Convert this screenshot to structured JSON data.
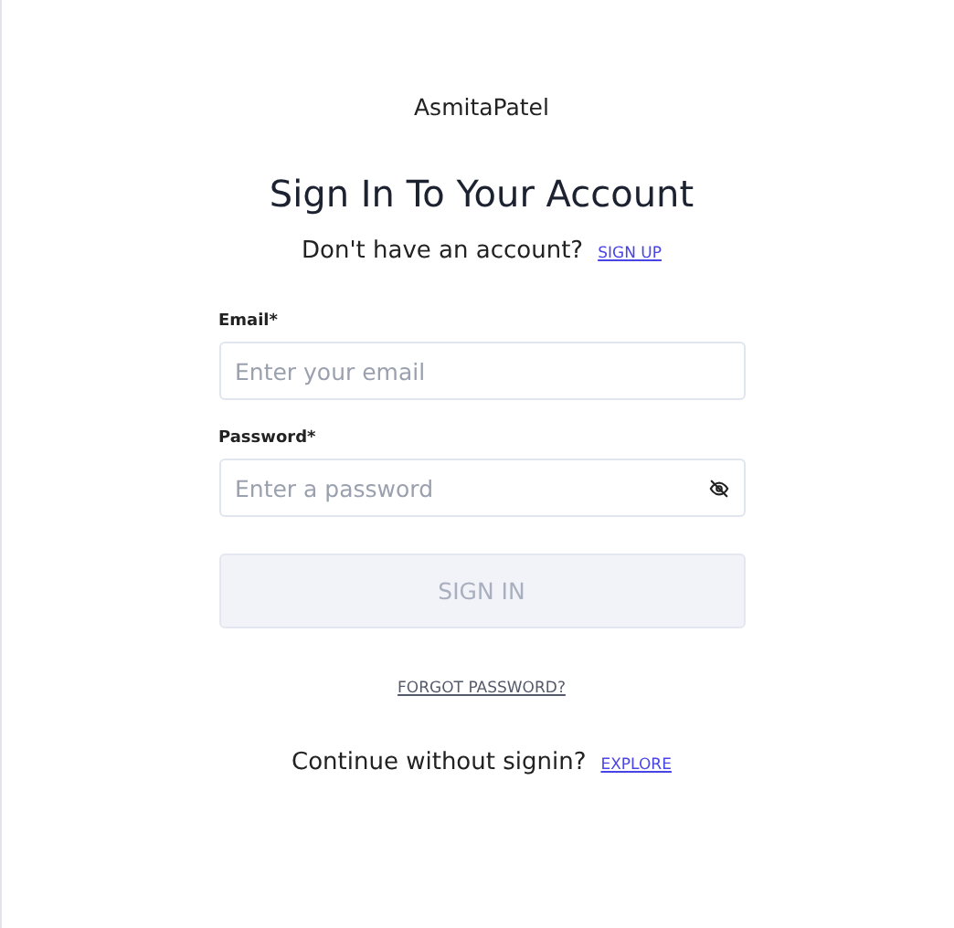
{
  "brand": "AsmitaPatel",
  "title": "Sign In To Your Account",
  "signup_prompt": {
    "text": "Don't have an account?",
    "link": "SIGN UP"
  },
  "fields": [
    {
      "label": "Email*",
      "placeholder": "Enter your email",
      "kind": "text"
    },
    {
      "label": "Password*",
      "placeholder": "Enter a password",
      "kind": "password"
    }
  ],
  "submit": {
    "label": "SIGN IN",
    "disabled": true
  },
  "forgot_link": "FORGOT PASSWORD?",
  "explore_prompt": {
    "text": "Continue without signin?",
    "link": "EXPLORE"
  }
}
